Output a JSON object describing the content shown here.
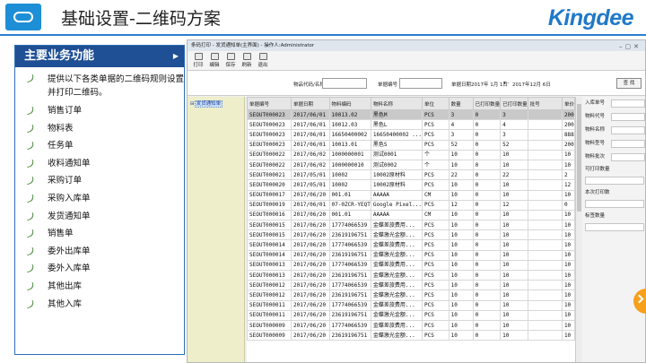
{
  "header": {
    "title": "基础设置-二维码方案",
    "brand": "Kingdee",
    "accent": "#1f79c9"
  },
  "panel": {
    "title": "主要业务功能",
    "items": [
      "提供以下各类单据的二维码规则设置并打印二维码。",
      "销售订单",
      "物料表",
      "任务单",
      "收料通知单",
      "采购订单",
      "采购入库单",
      "发货通知单",
      "销售单",
      "委外出库单",
      "委外入库单",
      "其他出库",
      "其他入库"
    ]
  },
  "window": {
    "title": "条码打印 - 发货通知单(主界面) - 操作人:Administrator",
    "toolbar": [
      "打印",
      "编辑",
      "保存",
      "刷新",
      "退出"
    ],
    "filter": {
      "label_item": "物品代码/名称",
      "label_bill": "单据编号",
      "label_date": "单据日期",
      "date_from": "2017年 1月 1日",
      "date_to": "2017年12月 6日",
      "query": "查 找"
    },
    "tree_node": "发货通知单",
    "columns": [
      "单据编号",
      "单据日期",
      "物料编码",
      "物料名称",
      "单位",
      "数量",
      "已打印数量",
      "已打印数量",
      "批号",
      "单价"
    ],
    "rows": [
      [
        "SEOUT000023",
        "2017/06/01",
        "10013.02",
        "黑色M",
        "PCS",
        "3",
        "0",
        "3",
        "",
        "200"
      ],
      [
        "SEOUT000023",
        "2017/06/01",
        "10012.03",
        "黑色L",
        "PCS",
        "4",
        "0",
        "4",
        "",
        "200"
      ],
      [
        "SEOUT000023",
        "2017/06/01",
        "16650400002",
        "16650400002 ...",
        "PCS",
        "3",
        "0",
        "3",
        "",
        "888"
      ],
      [
        "SEOUT000023",
        "2017/06/01",
        "10013.01",
        "黑色S",
        "PCS",
        "52",
        "0",
        "52",
        "",
        "200"
      ],
      [
        "SEOUT000022",
        "2017/06/02",
        "1000000001",
        "测试0001",
        "个",
        "10",
        "0",
        "10",
        "",
        "10"
      ],
      [
        "SEOUT000022",
        "2017/06/02",
        "1000000010",
        "测试0002",
        "个",
        "10",
        "0",
        "10",
        "",
        "10"
      ],
      [
        "SEOUT000021",
        "2017/05/01",
        "10002",
        "10002原材料",
        "PCS",
        "22",
        "0",
        "22",
        "",
        "2"
      ],
      [
        "SEOUT000020",
        "2017/05/01",
        "10002",
        "10002原材料",
        "PCS",
        "10",
        "0",
        "10",
        "",
        "12"
      ],
      [
        "SEOUT000017",
        "2017/06/20",
        "001.01",
        "AAAAA",
        "CM",
        "10",
        "0",
        "10",
        "",
        "10"
      ],
      [
        "SEOUT000019",
        "2017/06/01",
        "07-0ZCR-YEQT",
        "Google Pixel...",
        "PCS",
        "12",
        "0",
        "12",
        "",
        "0"
      ],
      [
        "SEOUT000016",
        "2017/06/20",
        "001.01",
        "AAAAA",
        "CM",
        "10",
        "0",
        "10",
        "",
        "10"
      ],
      [
        "SEOUT000015",
        "2017/06/20",
        "17774066539",
        "金蝶差旅费用...",
        "PCS",
        "10",
        "0",
        "10",
        "",
        "10"
      ],
      [
        "SEOUT000015",
        "2017/06/20",
        "23619196751",
        "金蝶激光金额...",
        "PCS",
        "10",
        "0",
        "10",
        "",
        "10"
      ],
      [
        "SEOUT000014",
        "2017/06/20",
        "17774066539",
        "金蝶差旅费用...",
        "PCS",
        "10",
        "0",
        "10",
        "",
        "10"
      ],
      [
        "SEOUT000014",
        "2017/06/20",
        "23619196751",
        "金蝶激光金额...",
        "PCS",
        "10",
        "0",
        "10",
        "",
        "10"
      ],
      [
        "SEOUT000013",
        "2017/06/20",
        "17774066539",
        "金蝶差旅费用...",
        "PCS",
        "10",
        "0",
        "10",
        "",
        "10"
      ],
      [
        "SEOUT000013",
        "2017/06/20",
        "23619196751",
        "金蝶激光金额...",
        "PCS",
        "10",
        "0",
        "10",
        "",
        "10"
      ],
      [
        "SEOUT000012",
        "2017/06/20",
        "17774066539",
        "金蝶差旅费用...",
        "PCS",
        "10",
        "0",
        "10",
        "",
        "10"
      ],
      [
        "SEOUT000012",
        "2017/06/20",
        "23619196751",
        "金蝶激光金额...",
        "PCS",
        "10",
        "0",
        "10",
        "",
        "10"
      ],
      [
        "SEOUT000011",
        "2017/06/20",
        "17774066539",
        "金蝶差旅费用...",
        "PCS",
        "10",
        "0",
        "10",
        "",
        "10"
      ],
      [
        "SEOUT000011",
        "2017/06/20",
        "23619196751",
        "金蝶激光金额...",
        "PCS",
        "10",
        "0",
        "10",
        "",
        "10"
      ],
      [
        "SEOUT000009",
        "2017/06/20",
        "17774066539",
        "金蝶差旅费用...",
        "PCS",
        "10",
        "0",
        "10",
        "",
        "10"
      ],
      [
        "SEOUT000009",
        "2017/06/20",
        "23619196751",
        "金蝶激光金额...",
        "PCS",
        "10",
        "0",
        "10",
        "",
        "10"
      ]
    ],
    "side_fields": [
      "入库单号",
      "物料代号",
      "物料名称",
      "物料型号",
      "物料批次",
      "可打印数量",
      "本次打印数",
      "标签数量"
    ]
  }
}
